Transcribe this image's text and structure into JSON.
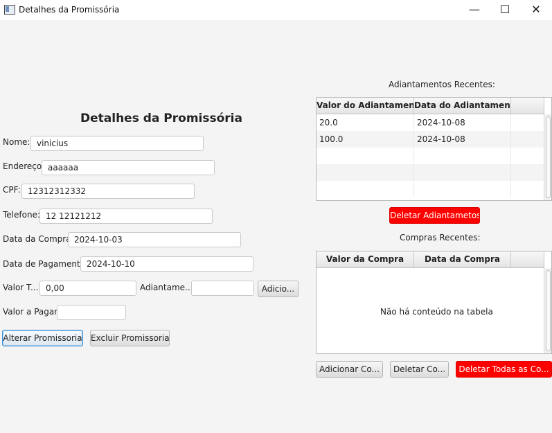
{
  "window": {
    "title": "Detalhes da Promissória",
    "minimize": "—",
    "maximize": "☐",
    "close": "✕"
  },
  "form": {
    "heading": "Detalhes da Promissória",
    "nome_label": "Nome:",
    "nome_value": "vinicius",
    "endereco_label": "Endereço:",
    "endereco_value": "aaaaaa",
    "cpf_label": "CPF:",
    "cpf_value": "12312312332",
    "telefone_label": "Telefone:",
    "telefone_value": "12 12121212",
    "data_compra_label": "Data da Compra:",
    "data_compra_value": "2024-10-03",
    "data_pagamento_label": "Data de Pagamento:",
    "data_pagamento_value": "2024-10-10",
    "valor_total_label": "Valor T...",
    "valor_total_value": "0,00",
    "adiantamento_label": "Adiantame...",
    "adiantamento_value": "",
    "adicionar_button": "Adicio...",
    "valor_pagar_label": "Valor a Pagar:",
    "valor_pagar_value": "",
    "alterar_button": "Alterar Promissoria",
    "excluir_button": "Excluir Promissoria"
  },
  "adiantamentos": {
    "title": "Adiantamentos Recentes:",
    "columns": [
      "Valor do Adiantamento",
      "Data do Adiantamento"
    ],
    "rows": [
      [
        "20.0",
        "2024-10-08"
      ],
      [
        "100.0",
        "2024-10-08"
      ]
    ],
    "delete_button": "Deletar Adiantametos"
  },
  "compras": {
    "title": "Compras Recentes:",
    "columns": [
      "Valor da Compra",
      "Data da Compra"
    ],
    "empty_message": "Não há conteúdo na tabela",
    "add_button": "Adicionar Co...",
    "delete_button": "Deletar Co...",
    "delete_all_button": "Deletar Todas as Co..."
  },
  "colors": {
    "danger": "#ff0000",
    "focus": "#3c8fd6"
  }
}
